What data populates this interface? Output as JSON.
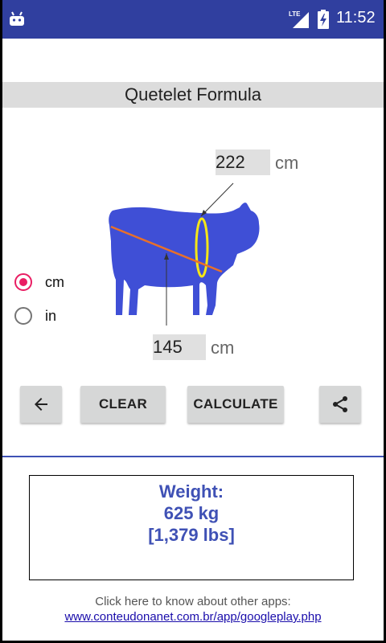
{
  "status_bar": {
    "network": "LTE",
    "time": "11:52",
    "icons": [
      "android-icon",
      "lte-signal-icon",
      "battery-charging-icon"
    ]
  },
  "title": "Quetelet Formula",
  "measurements": {
    "heart_girth": {
      "value": "222",
      "unit": "cm"
    },
    "body_length": {
      "value": "145",
      "unit": "cm"
    }
  },
  "units": {
    "options": [
      "cm",
      "in"
    ],
    "selected": "cm"
  },
  "buttons": {
    "back_icon": "arrow-left-icon",
    "clear": "CLEAR",
    "calculate": "CALCULATE",
    "share_icon": "share-icon"
  },
  "result": {
    "label": "Weight:",
    "kg": "625 kg",
    "lbs": "[1,379 lbs]"
  },
  "footer": {
    "text": "Click here to know about other apps:",
    "link": "www.conteudonanet.com.br/app/googleplay.php"
  },
  "colors": {
    "status_bar": "#303f9f",
    "accent": "#3f51b5",
    "radio_checked": "#e91e63",
    "cow": "#3f4fd6",
    "length_line": "#e8702a",
    "girth_line": "#f5e617"
  }
}
